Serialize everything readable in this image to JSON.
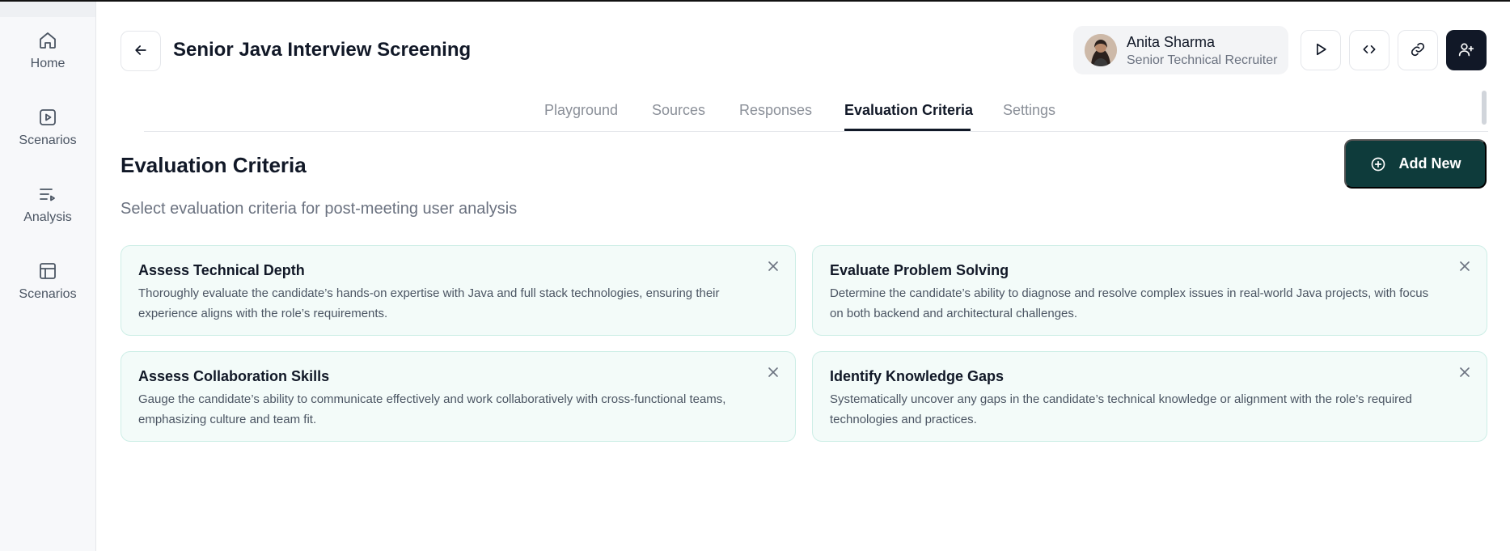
{
  "sidebar": {
    "items": [
      {
        "label": "Home",
        "icon": "home-icon"
      },
      {
        "label": "Scenarios",
        "icon": "play-square-icon"
      },
      {
        "label": "Analysis",
        "icon": "list-play-icon"
      },
      {
        "label": "Scenarios",
        "icon": "layout-icon"
      }
    ]
  },
  "header": {
    "title": "Senior Java Interview Screening",
    "profile": {
      "name": "Anita Sharma",
      "role": "Senior Technical Recruiter"
    }
  },
  "tabs": [
    {
      "label": "Playground",
      "active": false
    },
    {
      "label": "Sources",
      "active": false
    },
    {
      "label": "Responses",
      "active": false
    },
    {
      "label": "Evaluation Criteria",
      "active": true
    },
    {
      "label": "Settings",
      "active": false
    }
  ],
  "section": {
    "title": "Evaluation Criteria",
    "subtitle": "Select evaluation criteria for post-meeting user analysis",
    "add_label": "Add New"
  },
  "criteria": [
    {
      "title": "Assess Technical Depth",
      "description": "Thoroughly evaluate the candidate’s hands-on expertise with Java and full stack technologies, ensuring their experience aligns with the role’s requirements."
    },
    {
      "title": "Evaluate Problem Solving",
      "description": "Determine the candidate’s ability to diagnose and resolve complex issues in real-world Java projects, with focus on both backend and architectural challenges."
    },
    {
      "title": "Assess Collaboration Skills",
      "description": "Gauge the candidate’s ability to communicate effectively and work collaboratively with cross-functional teams, emphasizing culture and team fit."
    },
    {
      "title": "Identify Knowledge Gaps",
      "description": "Systematically uncover any gaps in the candidate’s technical knowledge or alignment with the role’s required technologies and practices."
    }
  ],
  "colors": {
    "accent": "#0e3b3b",
    "card_bg": "#f3fbf9",
    "card_border": "#cdeee6",
    "dark_button": "#111827"
  }
}
